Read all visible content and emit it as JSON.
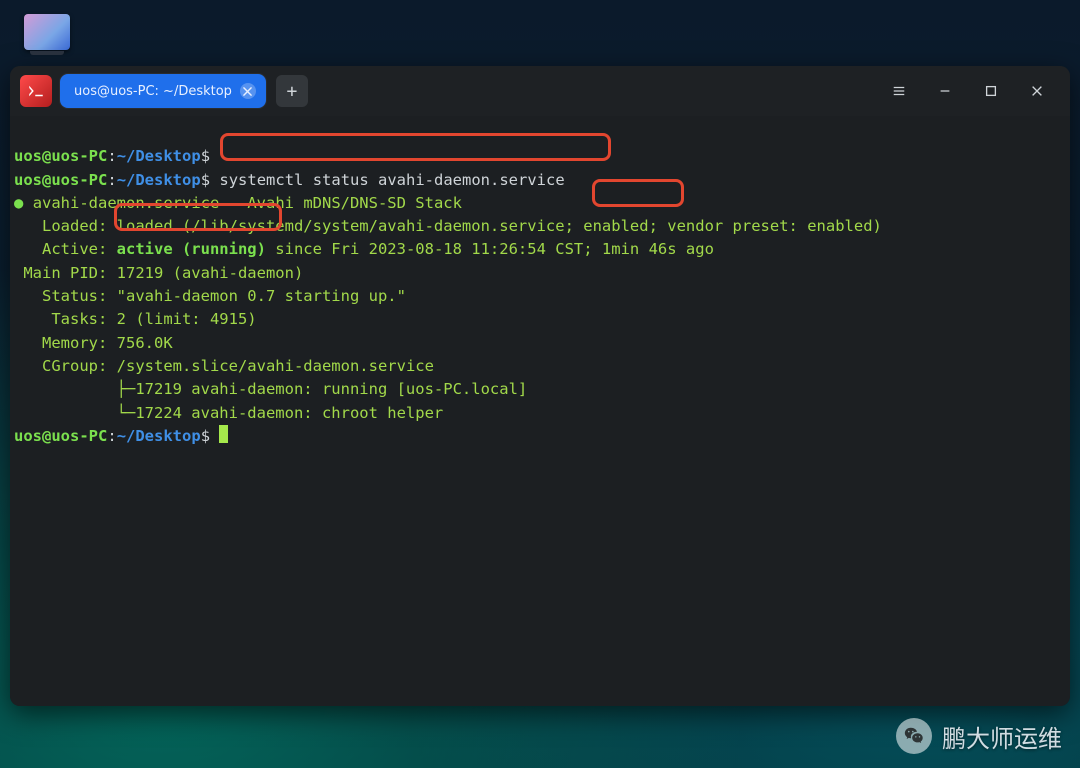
{
  "titlebar": {
    "tab_title": "uos@uos-PC: ~/Desktop",
    "app_icon": "terminal-icon",
    "new_tab_label": "+"
  },
  "prompt": {
    "user": "uos",
    "at": "@",
    "host": "uos-PC",
    "colon": ":",
    "path": "~/Desktop",
    "sigil": "$"
  },
  "command": "systemctl status avahi-daemon.service",
  "status": {
    "bullet": "●",
    "unit": "avahi-daemon.service",
    "dash": " - ",
    "desc": "Avahi mDNS/DNS-SD Stack",
    "loaded_label": "   Loaded: ",
    "loaded_pre": "loaded (/lib/systemd/system/avahi-daemon.service; ",
    "loaded_enabled": "enabled;",
    "loaded_post": " vendor preset: enabled)",
    "active_label": "   Active: ",
    "active_value": "active (running)",
    "active_since": " since Fri 2023-08-18 11:26:54 CST; 1min 46s ago",
    "mainpid_label": " Main PID: ",
    "mainpid_value": "17219 (avahi-daemon)",
    "status_label": "   Status: ",
    "status_value": "\"avahi-daemon 0.7 starting up.\"",
    "tasks_label": "    Tasks: ",
    "tasks_value": "2 (limit: 4915)",
    "memory_label": "   Memory: ",
    "memory_value": "756.0K",
    "cgroup_label": "   CGroup: ",
    "cgroup_value": "/system.slice/avahi-daemon.service",
    "cgroup_line1": "           ├─17219 avahi-daemon: running [uos-PC.local]",
    "cgroup_line2": "           └─17224 avahi-daemon: chroot helper"
  },
  "watermark": {
    "text": "鹏大师运维"
  },
  "annotations": {
    "hl1": "command-highlight",
    "hl2": "enabled-highlight",
    "hl3": "active-running-highlight"
  }
}
